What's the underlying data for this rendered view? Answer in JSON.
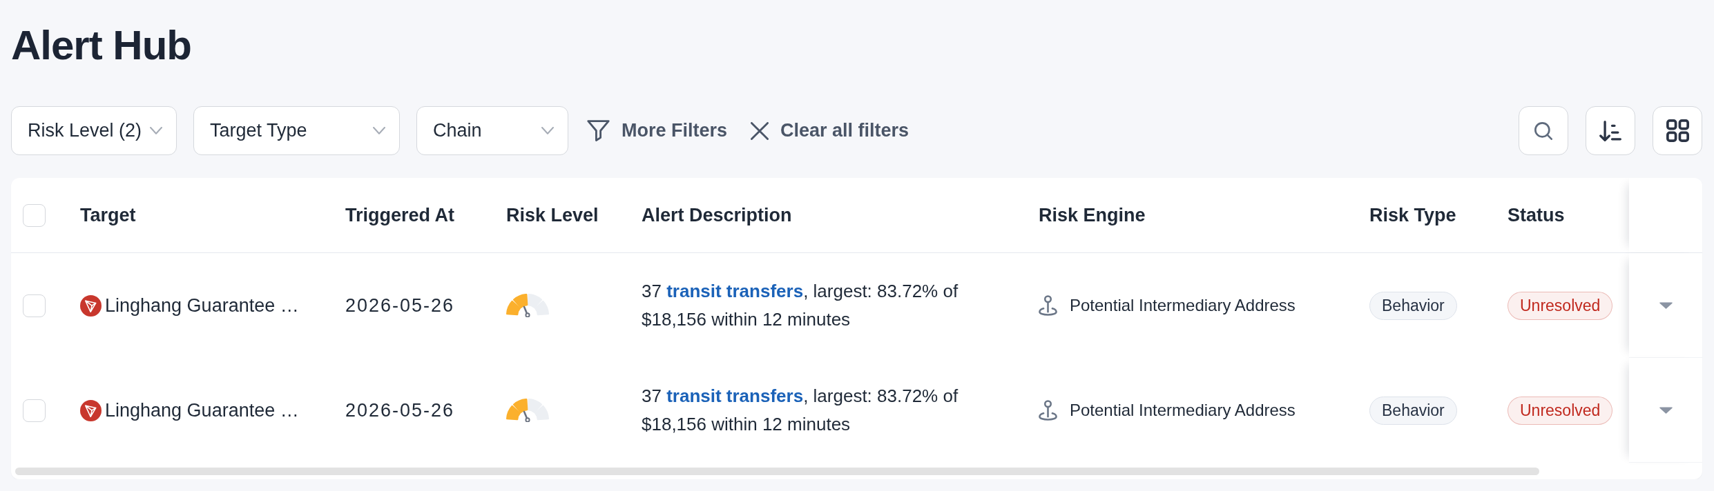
{
  "page": {
    "title": "Alert Hub"
  },
  "filters": {
    "dropdowns": [
      {
        "label": "Risk Level (2)"
      },
      {
        "label": "Target Type"
      },
      {
        "label": "Chain"
      }
    ],
    "actions": [
      {
        "kind": "more",
        "label": "More Filters"
      },
      {
        "kind": "clear",
        "label": "Clear all filters"
      }
    ]
  },
  "table": {
    "select_all": {
      "checked": false
    },
    "columns": [
      "Target",
      "Triggered At",
      "Risk Level",
      "Alert Description",
      "Risk Engine",
      "Risk Type",
      "Status"
    ],
    "rows": [
      {
        "checked": false,
        "target": "Linghang Guarantee …",
        "triggered_at": "2026-05-26",
        "risk_level": {
          "level": 0.5
        },
        "description": {
          "before": "37 ",
          "link": "transit transfers",
          "after": ", largest: 83.72% of $18,156 within 12 minutes"
        },
        "risk_engine": "Potential Intermediary Address",
        "risk_type": "Behavior",
        "status": {
          "label": "Unresolved",
          "color": "#c0281d"
        }
      },
      {
        "checked": false,
        "target": "Linghang Guarantee …",
        "triggered_at": "2026-05-26",
        "risk_level": {
          "level": 0.5
        },
        "description": {
          "before": "37 ",
          "link": "transit transfers",
          "after": ", largest: 83.72% of $18,156 within 12 minutes"
        },
        "risk_engine": "Potential Intermediary Address",
        "risk_type": "Behavior",
        "status": {
          "label": "Unresolved",
          "color": "#c0281d"
        }
      }
    ]
  }
}
